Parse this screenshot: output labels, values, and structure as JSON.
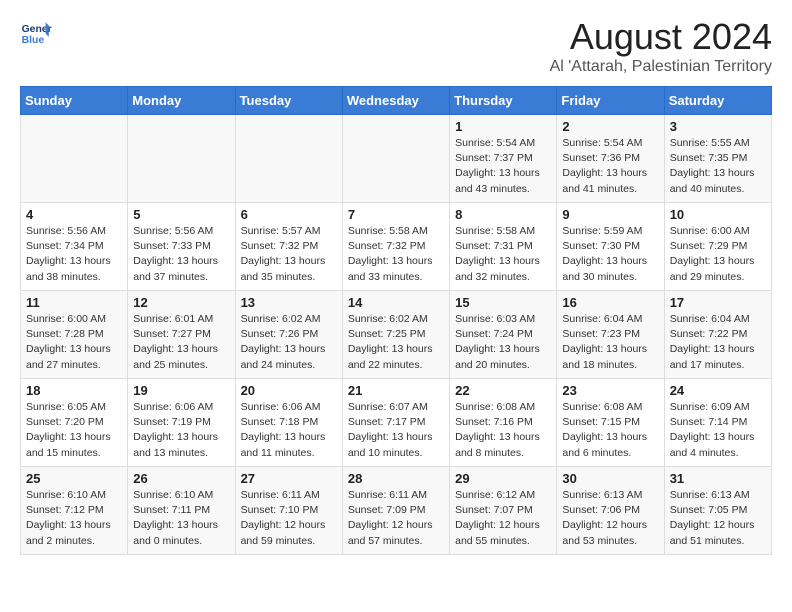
{
  "logo": {
    "line1": "General",
    "line2": "Blue"
  },
  "title": "August 2024",
  "subtitle": "Al 'Attarah, Palestinian Territory",
  "headers": [
    "Sunday",
    "Monday",
    "Tuesday",
    "Wednesday",
    "Thursday",
    "Friday",
    "Saturday"
  ],
  "weeks": [
    [
      {
        "day": "",
        "info": ""
      },
      {
        "day": "",
        "info": ""
      },
      {
        "day": "",
        "info": ""
      },
      {
        "day": "",
        "info": ""
      },
      {
        "day": "1",
        "info": "Sunrise: 5:54 AM\nSunset: 7:37 PM\nDaylight: 13 hours\nand 43 minutes."
      },
      {
        "day": "2",
        "info": "Sunrise: 5:54 AM\nSunset: 7:36 PM\nDaylight: 13 hours\nand 41 minutes."
      },
      {
        "day": "3",
        "info": "Sunrise: 5:55 AM\nSunset: 7:35 PM\nDaylight: 13 hours\nand 40 minutes."
      }
    ],
    [
      {
        "day": "4",
        "info": "Sunrise: 5:56 AM\nSunset: 7:34 PM\nDaylight: 13 hours\nand 38 minutes."
      },
      {
        "day": "5",
        "info": "Sunrise: 5:56 AM\nSunset: 7:33 PM\nDaylight: 13 hours\nand 37 minutes."
      },
      {
        "day": "6",
        "info": "Sunrise: 5:57 AM\nSunset: 7:32 PM\nDaylight: 13 hours\nand 35 minutes."
      },
      {
        "day": "7",
        "info": "Sunrise: 5:58 AM\nSunset: 7:32 PM\nDaylight: 13 hours\nand 33 minutes."
      },
      {
        "day": "8",
        "info": "Sunrise: 5:58 AM\nSunset: 7:31 PM\nDaylight: 13 hours\nand 32 minutes."
      },
      {
        "day": "9",
        "info": "Sunrise: 5:59 AM\nSunset: 7:30 PM\nDaylight: 13 hours\nand 30 minutes."
      },
      {
        "day": "10",
        "info": "Sunrise: 6:00 AM\nSunset: 7:29 PM\nDaylight: 13 hours\nand 29 minutes."
      }
    ],
    [
      {
        "day": "11",
        "info": "Sunrise: 6:00 AM\nSunset: 7:28 PM\nDaylight: 13 hours\nand 27 minutes."
      },
      {
        "day": "12",
        "info": "Sunrise: 6:01 AM\nSunset: 7:27 PM\nDaylight: 13 hours\nand 25 minutes."
      },
      {
        "day": "13",
        "info": "Sunrise: 6:02 AM\nSunset: 7:26 PM\nDaylight: 13 hours\nand 24 minutes."
      },
      {
        "day": "14",
        "info": "Sunrise: 6:02 AM\nSunset: 7:25 PM\nDaylight: 13 hours\nand 22 minutes."
      },
      {
        "day": "15",
        "info": "Sunrise: 6:03 AM\nSunset: 7:24 PM\nDaylight: 13 hours\nand 20 minutes."
      },
      {
        "day": "16",
        "info": "Sunrise: 6:04 AM\nSunset: 7:23 PM\nDaylight: 13 hours\nand 18 minutes."
      },
      {
        "day": "17",
        "info": "Sunrise: 6:04 AM\nSunset: 7:22 PM\nDaylight: 13 hours\nand 17 minutes."
      }
    ],
    [
      {
        "day": "18",
        "info": "Sunrise: 6:05 AM\nSunset: 7:20 PM\nDaylight: 13 hours\nand 15 minutes."
      },
      {
        "day": "19",
        "info": "Sunrise: 6:06 AM\nSunset: 7:19 PM\nDaylight: 13 hours\nand 13 minutes."
      },
      {
        "day": "20",
        "info": "Sunrise: 6:06 AM\nSunset: 7:18 PM\nDaylight: 13 hours\nand 11 minutes."
      },
      {
        "day": "21",
        "info": "Sunrise: 6:07 AM\nSunset: 7:17 PM\nDaylight: 13 hours\nand 10 minutes."
      },
      {
        "day": "22",
        "info": "Sunrise: 6:08 AM\nSunset: 7:16 PM\nDaylight: 13 hours\nand 8 minutes."
      },
      {
        "day": "23",
        "info": "Sunrise: 6:08 AM\nSunset: 7:15 PM\nDaylight: 13 hours\nand 6 minutes."
      },
      {
        "day": "24",
        "info": "Sunrise: 6:09 AM\nSunset: 7:14 PM\nDaylight: 13 hours\nand 4 minutes."
      }
    ],
    [
      {
        "day": "25",
        "info": "Sunrise: 6:10 AM\nSunset: 7:12 PM\nDaylight: 13 hours\nand 2 minutes."
      },
      {
        "day": "26",
        "info": "Sunrise: 6:10 AM\nSunset: 7:11 PM\nDaylight: 13 hours\nand 0 minutes."
      },
      {
        "day": "27",
        "info": "Sunrise: 6:11 AM\nSunset: 7:10 PM\nDaylight: 12 hours\nand 59 minutes."
      },
      {
        "day": "28",
        "info": "Sunrise: 6:11 AM\nSunset: 7:09 PM\nDaylight: 12 hours\nand 57 minutes."
      },
      {
        "day": "29",
        "info": "Sunrise: 6:12 AM\nSunset: 7:07 PM\nDaylight: 12 hours\nand 55 minutes."
      },
      {
        "day": "30",
        "info": "Sunrise: 6:13 AM\nSunset: 7:06 PM\nDaylight: 12 hours\nand 53 minutes."
      },
      {
        "day": "31",
        "info": "Sunrise: 6:13 AM\nSunset: 7:05 PM\nDaylight: 12 hours\nand 51 minutes."
      }
    ]
  ]
}
